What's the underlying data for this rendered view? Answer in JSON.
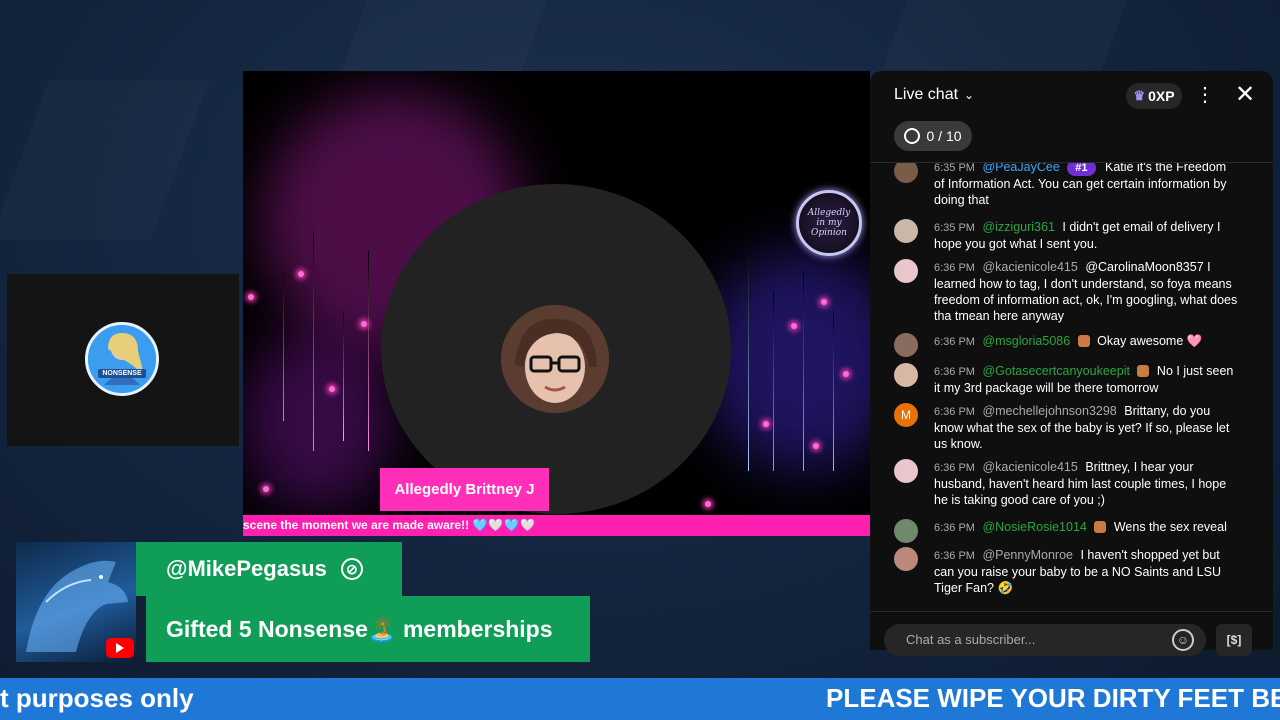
{
  "stream": {
    "pink_ticker": "scene the moment we are made aware!!",
    "pink_ticker_hearts": "🩵🤍🩵🤍",
    "name_tag": "Allegedly Brittney J",
    "logo_text": "Allegedly in my Opinion",
    "cam_logo_text": "NONSENSE"
  },
  "chat": {
    "title": "Live chat",
    "xp": "0XP",
    "goal": "0 / 10",
    "input_placeholder": "Chat as a subscriber...",
    "messages": [
      {
        "time": "6:35 PM",
        "author": "@PeaJayCee",
        "text": "Katie it's the Freedom of Information Act. You can get certain information by doing that",
        "rank": "#1",
        "avatar_color": "#7a5c49"
      },
      {
        "time": "6:35 PM",
        "author": "@izziguri361",
        "text": "I didn't get email of delivery I hope you got what I sent you.",
        "avatar_color": "#c9b8a8"
      },
      {
        "time": "6:36 PM",
        "author": "@kacienicole415",
        "text": "@CarolinaMoon8357 I learned how to tag, I don't understand, so foya means freedom of information act, ok, I'm googling, what does tha tmean here anyway",
        "avatar_color": "#e8c6cc"
      },
      {
        "time": "6:36 PM",
        "author": "@msgloria5086",
        "text": "Okay awesome 🩷",
        "avatar_color": "#8a6c5e"
      },
      {
        "time": "6:36 PM",
        "author": "@Gotasecertcanyoukeepit",
        "text": "No I just seen it my 3rd package will be there tomorrow",
        "avatar_color": "#d8b7a5"
      },
      {
        "time": "6:36 PM",
        "author": "@mechellejohnson3298",
        "text": "Brittany, do you know what the sex of the baby is yet? If so, please let us know.",
        "avatar_color": "#e8710a",
        "avatar_letter": "M"
      },
      {
        "time": "6:36 PM",
        "author": "@kacienicole415",
        "text": "Brittney, I hear your husband, haven't heard him last couple times, I hope he is taking good care of you ;)",
        "avatar_color": "#e8c6cc"
      },
      {
        "time": "6:36 PM",
        "author": "@NosieRosie1014",
        "text": "Wens the sex reveal",
        "avatar_color": "#6f8a6a"
      },
      {
        "time": "6:36 PM",
        "author": "@PennyMonroe",
        "text": "I haven't shopped yet but can you raise your baby to be a NO Saints and LSU Tiger Fan? 🤣",
        "avatar_color": "#b98a7a"
      }
    ]
  },
  "alert": {
    "username": "@MikePegasus",
    "gift_text": "Gifted 5 Nonsense🏝️ memberships"
  },
  "ticker": {
    "left_text": "t purposes only",
    "right_text": "PLEASE WIPE YOUR DIRTY FEET BEF"
  },
  "colors": {
    "accent_pink": "#ff1fb0",
    "alert_green": "#0f9d58",
    "ticker_blue": "#1f77d6",
    "mod_green": "#2ba640"
  }
}
